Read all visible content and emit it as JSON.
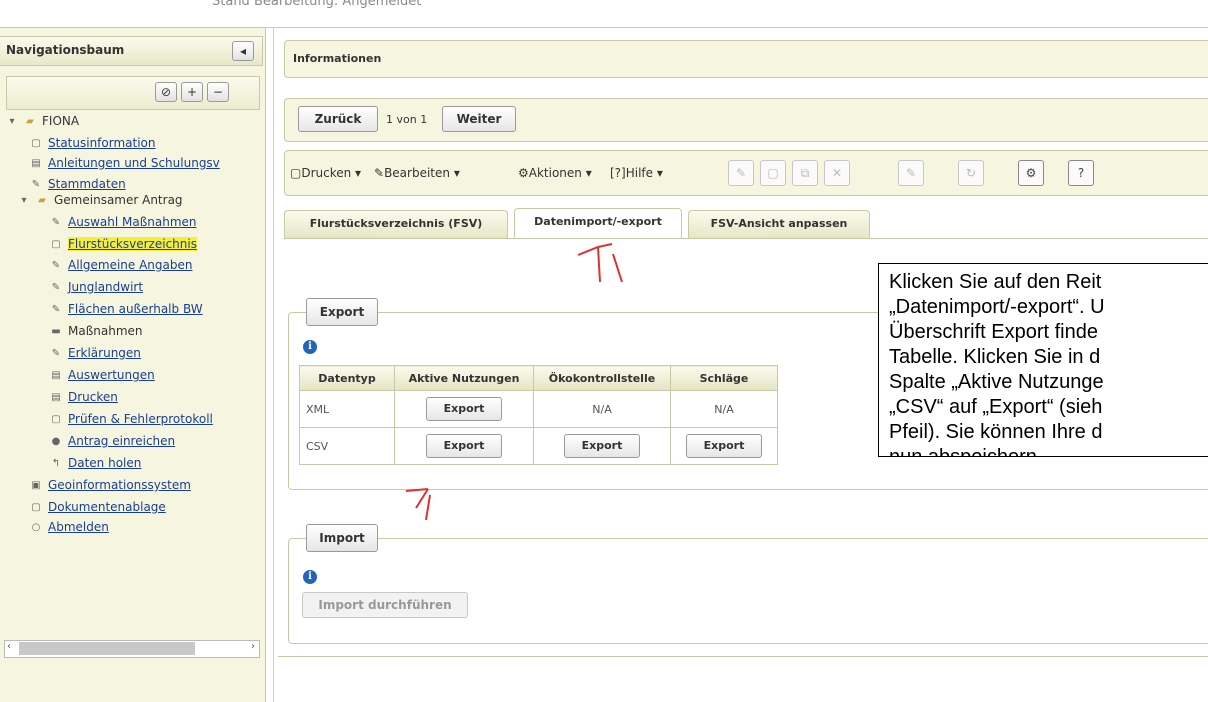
{
  "top_status": "Stand Bearbeitung: Angemeldet",
  "sidebar": {
    "title": "Navigationsbaum",
    "collapse_glyph": "◂",
    "tools": [
      "⊘",
      "+",
      "−"
    ],
    "tree": [
      {
        "label": "FIONA",
        "icon": "folder-open-icon",
        "link": false
      },
      {
        "label": "Statusinformation",
        "icon": "page-icon",
        "link": true
      },
      {
        "label": "Anleitungen und Schulungsv",
        "icon": "book-icon",
        "link": true
      },
      {
        "label": "Stammdaten",
        "icon": "pencil-icon",
        "link": true
      },
      {
        "label": "Gemeinsamer Antrag",
        "icon": "folder-open-icon",
        "link": false
      },
      {
        "label": "Auswahl Maßnahmen",
        "icon": "pencil-icon",
        "link": true
      },
      {
        "label": "Flurstücksverzeichnis",
        "icon": "page-icon",
        "link": true
      },
      {
        "label": "Allgemeine Angaben",
        "icon": "pencil-icon",
        "link": true
      },
      {
        "label": "Junglandwirt",
        "icon": "pencil-icon",
        "link": true
      },
      {
        "label": "Flächen außerhalb BW",
        "icon": "pencil-icon",
        "link": true
      },
      {
        "label": "Maßnahmen",
        "icon": "folder-icon",
        "link": false
      },
      {
        "label": "Erklärungen",
        "icon": "pencil-icon",
        "link": true
      },
      {
        "label": "Auswertungen",
        "icon": "book-icon",
        "link": true
      },
      {
        "label": "Drucken",
        "icon": "printer-icon",
        "link": true
      },
      {
        "label": "Prüfen & Fehlerprotokoll",
        "icon": "page-icon",
        "link": true
      },
      {
        "label": "Antrag einreichen",
        "icon": "lock-icon",
        "link": true
      },
      {
        "label": "Daten holen",
        "icon": "arrow-icon",
        "link": true
      },
      {
        "label": "Geoinformationssystem",
        "icon": "map-icon",
        "link": true
      },
      {
        "label": "Dokumentenablage",
        "icon": "page-icon",
        "link": true
      },
      {
        "label": "Abmelden",
        "icon": "power-icon",
        "link": true
      }
    ]
  },
  "info_panel": {
    "title": "Informationen"
  },
  "pager": {
    "back": "Zurück",
    "status": "1 von 1",
    "next": "Weiter"
  },
  "toolbar": {
    "print": "Drucken",
    "edit": "Bearbeiten",
    "actions": "Aktionen",
    "help": "Hilfe"
  },
  "tabs": [
    "Flurstücksverzeichnis (FSV)",
    "Datenimport/-export",
    "FSV-Ansicht anpassen"
  ],
  "export": {
    "legend": "Export",
    "headers": [
      "Datentyp",
      "Aktive Nutzungen",
      "Ökokontrollstelle",
      "Schläge"
    ],
    "rows": [
      [
        "XML",
        "Export",
        "N/A",
        "N/A"
      ],
      [
        "CSV",
        "Export",
        "Export",
        "Export"
      ]
    ]
  },
  "import": {
    "legend": "Import",
    "button": "Import durchführen"
  },
  "note": {
    "lines": [
      "Klicken Sie auf den Reit",
      "„Datenimport/-export“. U",
      "Überschrift Export finde",
      "Tabelle. Klicken Sie in d",
      "Spalte „Aktive Nutzunge",
      "„CSV“ auf „Export“ (sieh",
      "Pfeil). Sie können Ihre d",
      "nun abspeichern."
    ]
  },
  "colors": {
    "highlight": "#f6ef3a",
    "panel": "#f6f6e0",
    "link": "#1a3f8f",
    "annotation": "#e03030"
  }
}
